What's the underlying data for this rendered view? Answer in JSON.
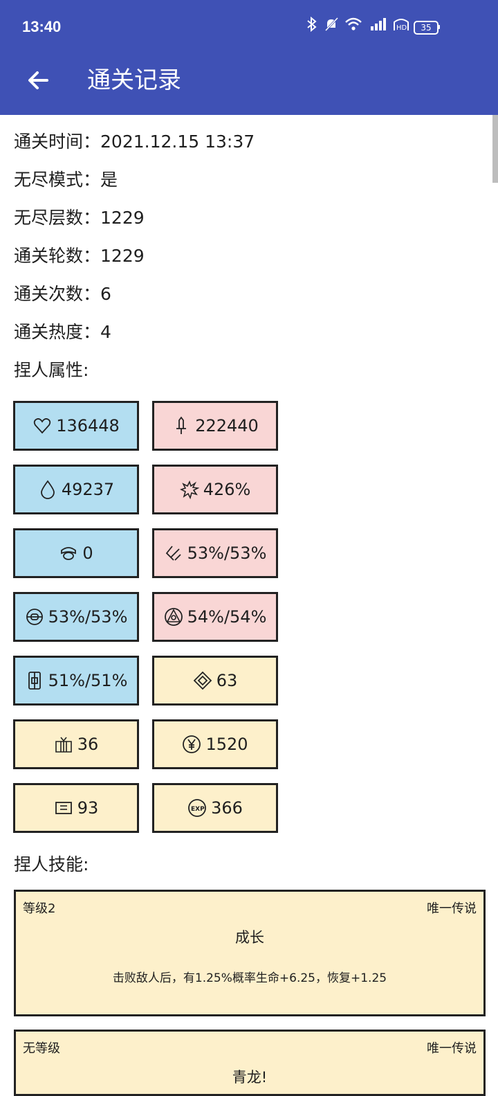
{
  "status_bar": {
    "time": "13:40",
    "battery": "35",
    "icons": [
      "bluetooth-icon",
      "mute-icon",
      "wifi-icon",
      "signal-4g-icon",
      "hd-icon"
    ]
  },
  "app_bar": {
    "title": "通关记录",
    "back_icon": "arrow-left-icon"
  },
  "colors": {
    "primary": "#3f51b5",
    "defense": "#b3def1",
    "attack": "#f9d6d5",
    "resource": "#fdf0cb"
  },
  "info": [
    {
      "label": "通关时间",
      "value": "2021.12.15 13:37"
    },
    {
      "label": "无尽模式",
      "value": "是"
    },
    {
      "label": "无尽层数",
      "value": "1229"
    },
    {
      "label": "通关轮数",
      "value": "1229"
    },
    {
      "label": "通关次数",
      "value": "6"
    },
    {
      "label": "通关热度",
      "value": "4"
    }
  ],
  "attributes_title": "捏人属性:",
  "stats": [
    {
      "icon": "heart-icon",
      "value": "136448",
      "color": "blue"
    },
    {
      "icon": "sword-icon",
      "value": "222440",
      "color": "pink"
    },
    {
      "icon": "drop-icon",
      "value": "49237",
      "color": "blue"
    },
    {
      "icon": "burst-icon",
      "value": "426%",
      "color": "pink"
    },
    {
      "icon": "helmet-icon",
      "value": "0",
      "color": "blue"
    },
    {
      "icon": "slash-icon",
      "value": "53%/53%",
      "color": "pink"
    },
    {
      "icon": "shield-ring-icon",
      "value": "53%/53%",
      "color": "blue"
    },
    {
      "icon": "triangle-circle-icon",
      "value": "54%/54%",
      "color": "pink"
    },
    {
      "icon": "armor-icon",
      "value": "51%/51%",
      "color": "blue"
    },
    {
      "icon": "diamond-icon",
      "value": "63",
      "color": "yellow"
    },
    {
      "icon": "gift-icon",
      "value": "36",
      "color": "yellow"
    },
    {
      "icon": "yen-coin-icon",
      "value": "1520",
      "color": "yellow"
    },
    {
      "icon": "card-icon",
      "value": "93",
      "color": "yellow"
    },
    {
      "icon": "exp-icon",
      "value": "366",
      "color": "yellow"
    }
  ],
  "skills_title": "捏人技能:",
  "skills": [
    {
      "level": "等级2",
      "rarity": "唯一传说",
      "name": "成长",
      "desc": "击败敌人后，有1.25%概率生命+6.25，恢复+1.25"
    },
    {
      "level": "无等级",
      "rarity": "唯一传说",
      "name": "青龙!",
      "desc": ""
    }
  ]
}
